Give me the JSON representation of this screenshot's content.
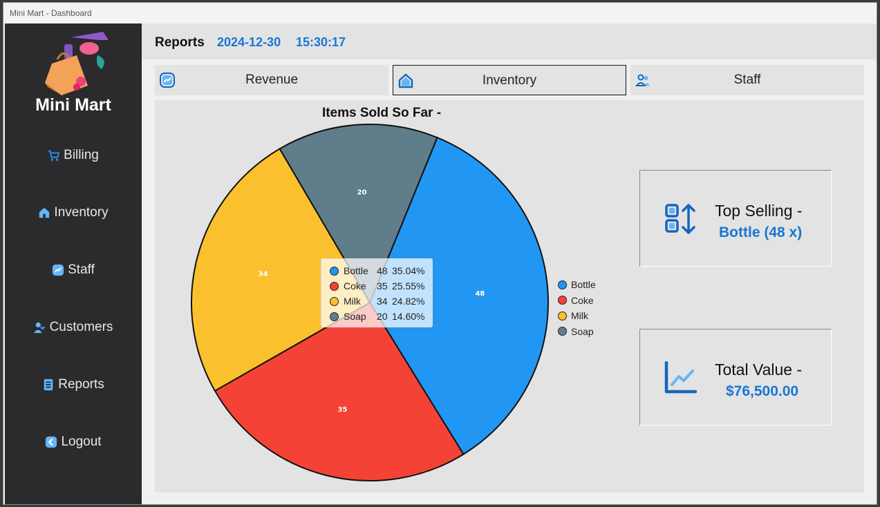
{
  "window": {
    "title": "Mini Mart - Dashboard"
  },
  "sidebar": {
    "brand": "Mini Mart",
    "items": [
      {
        "label": "Billing",
        "icon": "cart-icon"
      },
      {
        "label": "Inventory",
        "icon": "home-icon"
      },
      {
        "label": "Staff",
        "icon": "trend-icon"
      },
      {
        "label": "Customers",
        "icon": "user-heart-icon"
      },
      {
        "label": "Reports",
        "icon": "document-icon"
      },
      {
        "label": "Logout",
        "icon": "back-arrow-icon"
      }
    ]
  },
  "header": {
    "title": "Reports",
    "date": "2024-12-30",
    "time": "15:30:17"
  },
  "tabs": [
    {
      "label": "Revenue",
      "icon": "trend-icon",
      "active": false
    },
    {
      "label": "Inventory",
      "icon": "home-icon",
      "active": true
    },
    {
      "label": "Staff",
      "icon": "users-icon",
      "active": false
    }
  ],
  "chart_data": {
    "type": "pie",
    "title": "Items Sold So Far -",
    "categories": [
      "Bottle",
      "Coke",
      "Milk",
      "Soap"
    ],
    "values": [
      48,
      35,
      34,
      20
    ],
    "percentages": [
      "35.04%",
      "25.55%",
      "24.82%",
      "14.60%"
    ],
    "colors": [
      "#2196f3",
      "#f44336",
      "#fbc02d",
      "#607d8b"
    ],
    "legend_position": "right"
  },
  "tooltip": {
    "rows": [
      {
        "name": "Bottle",
        "value": "48",
        "percent": "35.04%"
      },
      {
        "name": "Coke",
        "value": "35",
        "percent": "25.55%"
      },
      {
        "name": "Milk",
        "value": "34",
        "percent": "24.82%"
      },
      {
        "name": "Soap",
        "value": "20",
        "percent": "14.60%"
      }
    ]
  },
  "cards": {
    "top_selling": {
      "label": "Top Selling -",
      "value": "Bottle (48 x)",
      "icon": "sort-icon"
    },
    "total_value": {
      "label": "Total Value -",
      "value": "$76,500.00",
      "icon": "line-chart-icon"
    }
  },
  "colors": {
    "accent": "#1976d2",
    "sidebar_bg": "#2b2a2c"
  }
}
